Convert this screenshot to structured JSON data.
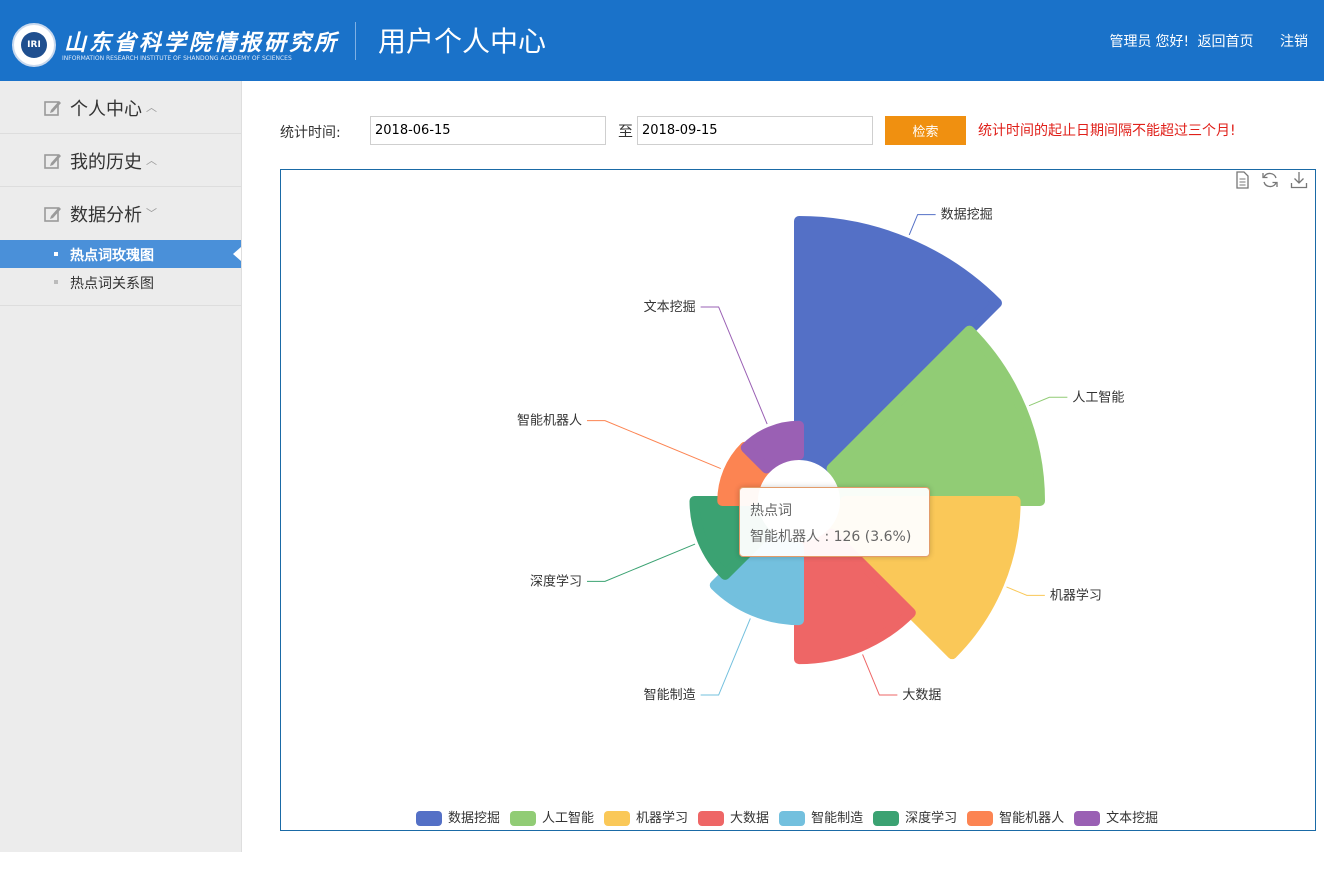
{
  "header": {
    "logo_mark": "IRI",
    "institute_name": "山东省科学院情报研究所",
    "institute_name_en": "INFORMATION RESEARCH INSTITUTE OF SHANDONG ACADEMY OF SCIENCES",
    "title": "用户个人中心",
    "greeting_user": "管理员",
    "greeting": "您好!",
    "home_link": "返回首页",
    "logout_link": "注销",
    "bg_color": "#1a72c9"
  },
  "sidebar": {
    "groups": [
      {
        "label": "个人中心",
        "icon": "edit-icon",
        "state": "collapsed"
      },
      {
        "label": "我的历史",
        "icon": "edit-icon",
        "state": "collapsed"
      },
      {
        "label": "数据分析",
        "icon": "edit-icon",
        "state": "expanded"
      }
    ],
    "sub_items": [
      {
        "label": "热点词玫瑰图",
        "active": true
      },
      {
        "label": "热点词关系图",
        "active": false
      }
    ],
    "active_color": "#4a90d9"
  },
  "filter": {
    "label": "统计时间:",
    "start_date": "2018-06-15",
    "to_text": "至",
    "end_date": "2018-09-15",
    "search_label": "检索",
    "warning": "统计时间的起止日期间隔不能超过三个月!",
    "button_color": "#f09010",
    "warning_color": "#e0201a"
  },
  "toolbox": [
    "data-view-icon",
    "restore-icon",
    "save-image-icon"
  ],
  "tooltip": {
    "title": "热点词",
    "text": "智能机器人 : 126 (3.6%)"
  },
  "chart_data": {
    "type": "pie",
    "subtype": "rose",
    "legend_position": "bottom",
    "series_name": "热点词",
    "categories": [
      "数据挖掘",
      "人工智能",
      "机器学习",
      "大数据",
      "智能制造",
      "深度学习",
      "智能机器人",
      "文本挖掘"
    ],
    "values": [
      960,
      800,
      700,
      460,
      300,
      240,
      126,
      120
    ],
    "colors": [
      "#5470c6",
      "#91cc75",
      "#fac858",
      "#ee6666",
      "#73c0de",
      "#3ba272",
      "#fc8452",
      "#9a60b4"
    ]
  }
}
